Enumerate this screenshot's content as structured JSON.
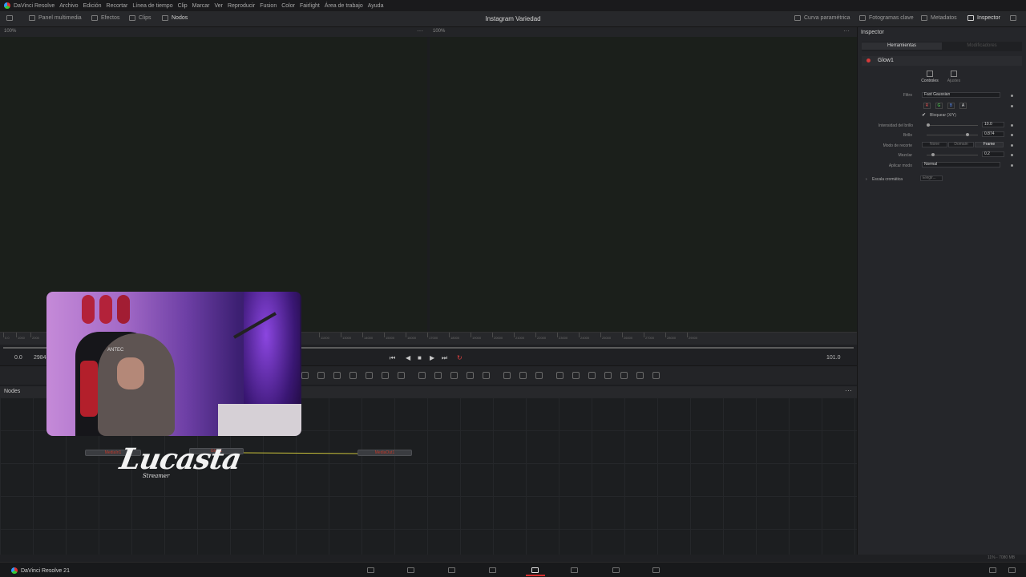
{
  "menu": [
    "DaVinci Resolve",
    "Archivo",
    "Edición",
    "Recortar",
    "Línea de tiempo",
    "Clip",
    "Marcar",
    "Ver",
    "Reproducir",
    "Fusion",
    "Color",
    "Fairlight",
    "Área de trabajo",
    "Ayuda"
  ],
  "toolbar": {
    "panel_multimedia": "Panel multimedia",
    "efectos": "Efectos",
    "clips": "Clips",
    "nodos": "Nodos",
    "curva_parametrica": "Curva paramétrica",
    "fotogramas_clave": "Fotogramas clave",
    "metadatos": "Metadatos",
    "inspector": "Inspector"
  },
  "project_title": "Instagram Variedad",
  "viewer": {
    "zoom_left": "100%",
    "zoom_right": "100%",
    "dots": "···"
  },
  "ruler_ticks": [
    "0.0",
    "1000",
    "2000",
    "11000",
    "13000",
    "14000",
    "15000",
    "16000",
    "17000",
    "18000",
    "19000",
    "20000",
    "21000",
    "22000",
    "23000",
    "24000",
    "25000",
    "26000",
    "27000",
    "28000",
    "29000"
  ],
  "transport": {
    "start": "0.0",
    "frame": "29845",
    "end": "101.0"
  },
  "nodes_panel": {
    "title": "Nodes",
    "menu": "···",
    "node_left": "MediaIn1",
    "node_mid": "Glow1",
    "node_right": "MediaOut1"
  },
  "webcam": {
    "shirt_text": "ANTEC"
  },
  "watermark": {
    "name": "Lucasta",
    "sub": "Streamer"
  },
  "inspector": {
    "title": "Inspector",
    "tabs": [
      "Herramientas",
      "Modificadores"
    ],
    "node_name": "Glow1",
    "subtabs": [
      "Controles",
      "Ajustes"
    ],
    "filtro_label": "Filtro",
    "filtro_value": "Fast Gaussian",
    "channels": [
      "R",
      "G",
      "B",
      "A"
    ],
    "bloquear": "Bloquear (X/Y)",
    "intensidad_label": "Intensidad del brillo",
    "intensidad_value": "10.0",
    "brillo_label": "Brillo",
    "brillo_value": "0.874",
    "modo_recorte_label": "Modo de recorte",
    "modo_recorte_options": [
      "None",
      "Domain",
      "Frame"
    ],
    "mezclar_label": "Mezclar",
    "mezclar_value": "0.2",
    "aplicar_modo_label": "Aplicar modo",
    "aplicar_modo_value": "Normal",
    "escala_label": "Escala cromática",
    "escala_value": "Elegir..."
  },
  "status": {
    "memory": "11% - 7080 MB"
  },
  "pagebar": {
    "app_name": "DaVinci Resolve 21",
    "pages": [
      "media-page-icon",
      "cut-page-icon",
      "edit-page-icon",
      "fusion-page-icon",
      "color-page-icon",
      "fairlight-page-icon",
      "deliver-page-icon"
    ]
  }
}
